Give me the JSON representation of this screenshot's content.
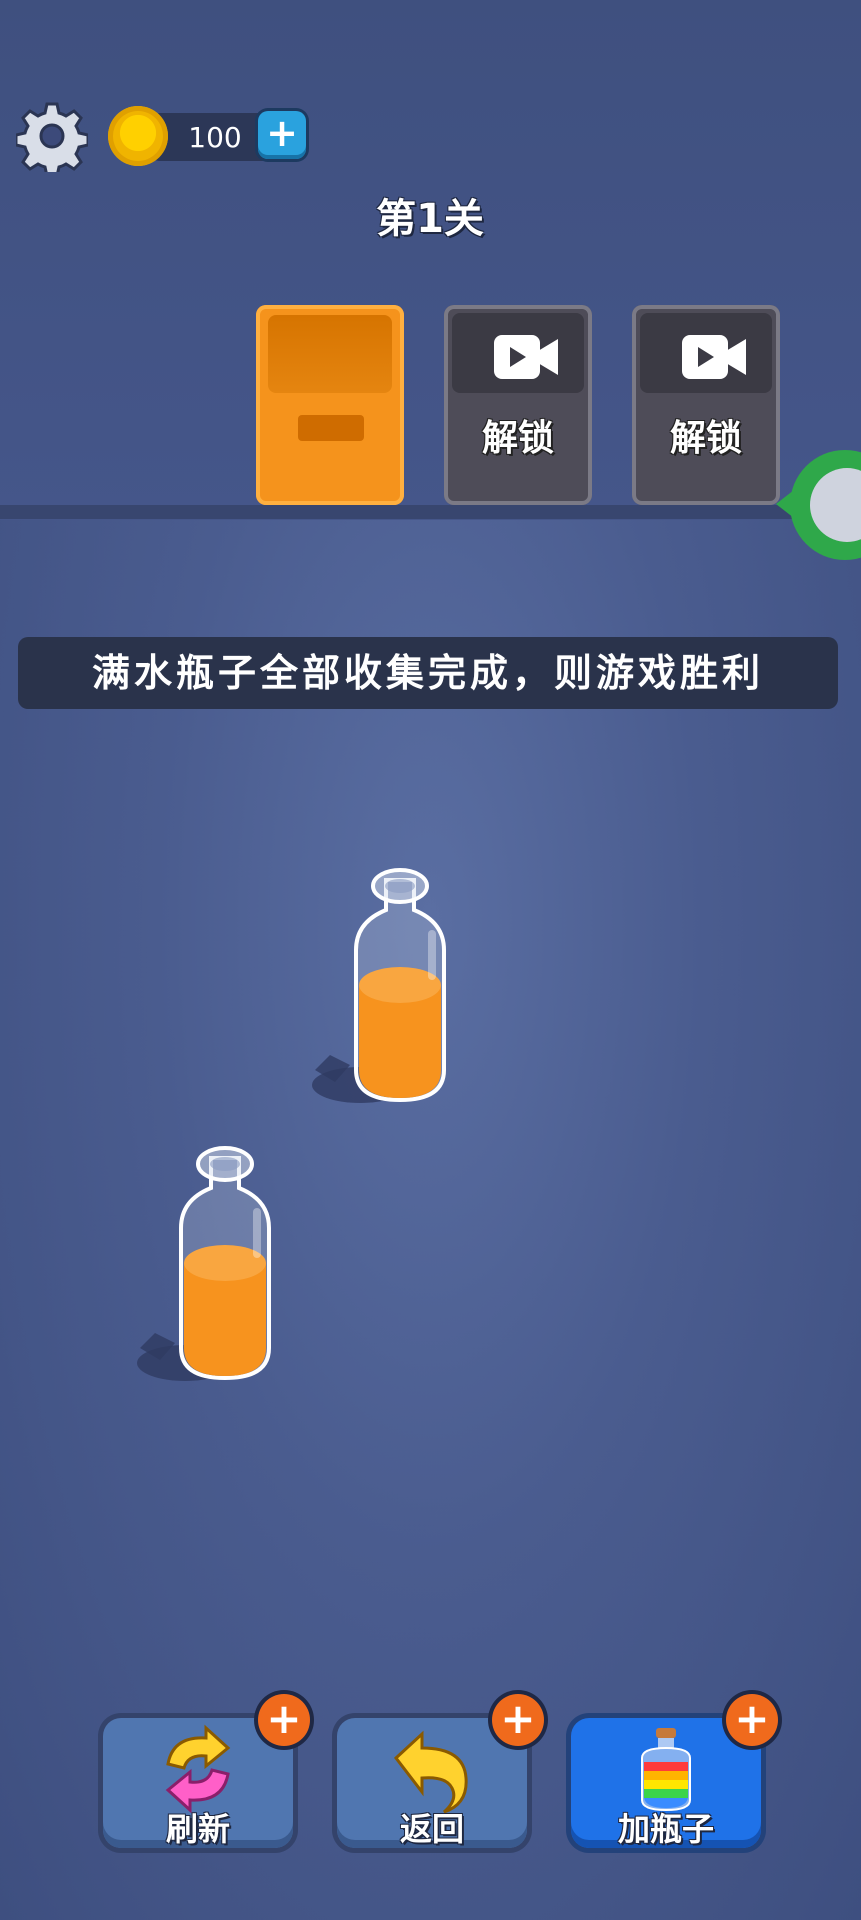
{
  "header": {
    "coins": "100",
    "coin_plus": "+",
    "level_title": "第1关"
  },
  "slots": [
    {
      "state": "open",
      "color": "#f5931c"
    },
    {
      "state": "locked",
      "icon": "video-camera-icon",
      "label": "解锁"
    },
    {
      "state": "locked",
      "icon": "video-camera-icon",
      "label": "解锁"
    }
  ],
  "hint": "满水瓶子全部收集完成，则游戏胜利",
  "bottles": [
    {
      "liquid_color": "#f7931e",
      "fill_level": 0.55
    },
    {
      "liquid_color": "#f7931e",
      "fill_level": 0.55
    }
  ],
  "buttons": [
    {
      "label": "刷新",
      "icon": "refresh-arrows-icon",
      "plus": "+"
    },
    {
      "label": "返回",
      "icon": "undo-arrow-icon",
      "plus": "+"
    },
    {
      "label": "加瓶子",
      "icon": "rainbow-bottle-icon",
      "plus": "+"
    }
  ],
  "colors": {
    "accent_orange": "#f5931c",
    "plus_badge": "#f06a1c",
    "blue_button": "#1f72e8"
  }
}
